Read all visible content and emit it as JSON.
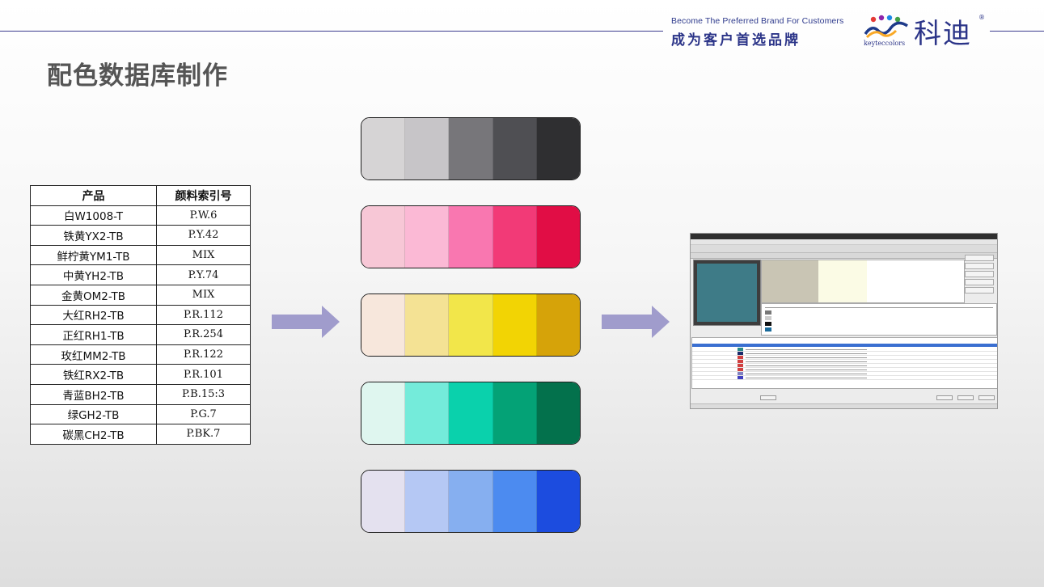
{
  "header": {
    "slogan_en": "Become The Preferred Brand For Customers",
    "slogan_cn": "成为客户首选品牌",
    "brand_cn": "科迪",
    "brand_en": "keyteccolors",
    "registered_mark": "®"
  },
  "page_title": "配色数据库制作",
  "table": {
    "headers": [
      "产品",
      "颜料索引号"
    ],
    "rows": [
      [
        "白W1008-T",
        "P.W.6"
      ],
      [
        "铁黄YX2-TB",
        "P.Y.42"
      ],
      [
        "鲜柠黄YM1-TB",
        "MIX"
      ],
      [
        "中黄YH2-TB",
        "P.Y.74"
      ],
      [
        "金黄OM2-TB",
        "MIX"
      ],
      [
        "大红RH2-TB",
        "P.R.112"
      ],
      [
        "正红RH1-TB",
        "P.R.254"
      ],
      [
        "玫红MM2-TB",
        "P.R.122"
      ],
      [
        "铁红RX2-TB",
        "P.R.101"
      ],
      [
        "青蓝BH2-TB",
        "P.B.15:3"
      ],
      [
        "绿GH2-TB",
        "P.G.7"
      ],
      [
        "碳黑CH2-TB",
        "P.BK.7"
      ]
    ]
  },
  "swatch_bars": [
    {
      "name": "gray",
      "colors": [
        "#d6d4d5",
        "#c7c5c8",
        "#77767a",
        "#4f4f53",
        "#2f2f31"
      ]
    },
    {
      "name": "pink",
      "colors": [
        "#f7c7d6",
        "#fbb9d5",
        "#f977b0",
        "#f23a77",
        "#e10d45"
      ]
    },
    {
      "name": "yellow",
      "colors": [
        "#f7e7dc",
        "#f4e294",
        "#f2e64a",
        "#f2d404",
        "#d6a309"
      ]
    },
    {
      "name": "green",
      "colors": [
        "#dff6ef",
        "#74ebda",
        "#0ad1ac",
        "#04a276",
        "#03714c"
      ]
    },
    {
      "name": "blue",
      "colors": [
        "#e4e1ef",
        "#b5c8f4",
        "#86aff0",
        "#4c8bf0",
        "#1c4cdf"
      ]
    }
  ],
  "software": {
    "preview_color": "#3e7b87",
    "row_colors": [
      "#2a8a8a",
      "#1a2a6a",
      "#d04040",
      "#d04040",
      "#d04040",
      "#d04040",
      "#8080c0",
      "#4040c0"
    ],
    "side_buttons": [
      "",
      "",
      "",
      "",
      ""
    ]
  },
  "arrow_color": "#a09ccc"
}
